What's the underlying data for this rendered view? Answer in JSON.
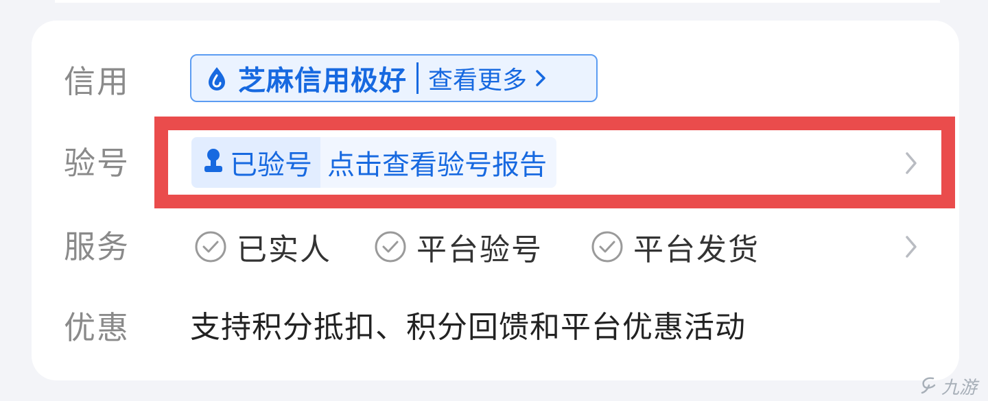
{
  "rows": {
    "credit": {
      "label": "信用",
      "badge_text": "芝麻信用极好",
      "more_link": "查看更多"
    },
    "verify": {
      "label": "验号",
      "status_text": "已验号",
      "report_link": "点击查看验号报告"
    },
    "service": {
      "label": "服务",
      "items": [
        {
          "label": "已实人",
          "icon": "check-circle-icon"
        },
        {
          "label": "平台验号",
          "icon": "check-circle-icon"
        },
        {
          "label": "平台发货",
          "icon": "check-circle-icon"
        }
      ]
    },
    "discount": {
      "label": "优惠",
      "text": "支持积分抵扣、积分回馈和平台优惠活动"
    }
  },
  "watermark": {
    "text": "九游",
    "icon": "jiuyou-logo-icon"
  },
  "colors": {
    "accent_blue": "#1769e0",
    "highlight_red": "#ea4c4c",
    "label_gray": "#8a8a8a",
    "page_background": "#f3f4f8"
  }
}
